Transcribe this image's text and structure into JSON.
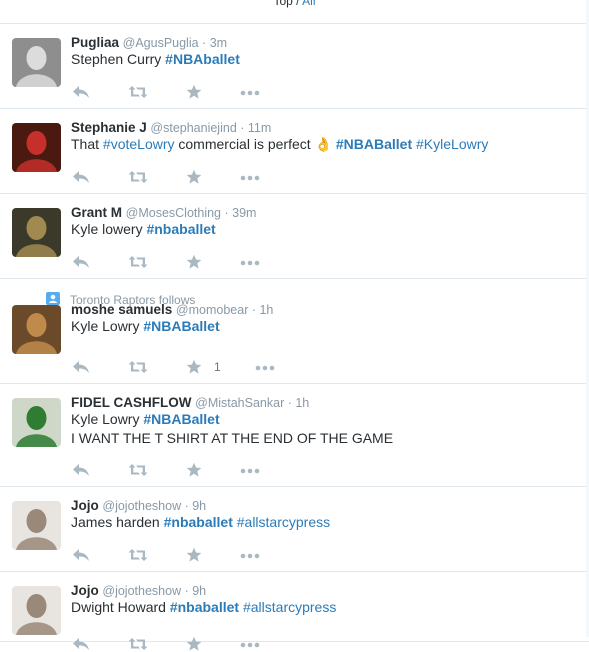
{
  "filter": {
    "top_label": "Top",
    "separator": " / ",
    "all_label": "All"
  },
  "tweets": [
    {
      "fullname": "Pugliaa",
      "username": "@AgusPuglia",
      "time": "3m",
      "text_parts": [
        {
          "t": "Stephen Curry "
        },
        {
          "t": "#NBAballet",
          "tag": true,
          "bold": true
        }
      ],
      "avatar_colors": [
        "#8e8e8e",
        "#dcdcdc"
      ]
    },
    {
      "fullname": "Stephanie J",
      "username": "@stephaniejind",
      "time": "11m",
      "text_parts": [
        {
          "t": "That "
        },
        {
          "t": "#voteLowry",
          "tag": true
        },
        {
          "t": " commercial is perfect "
        },
        {
          "t": "👌",
          "emoji": true
        },
        {
          "t": " "
        },
        {
          "t": "#NBABallet",
          "tag": true,
          "bold": true
        },
        {
          "t": " "
        },
        {
          "t": "#KyleLowry",
          "tag": true
        }
      ],
      "avatar_colors": [
        "#4a1a10",
        "#c62f2a"
      ]
    },
    {
      "fullname": "Grant M",
      "username": "@MosesClothing",
      "time": "39m",
      "text_parts": [
        {
          "t": "Kyle lowery "
        },
        {
          "t": "#nbaballet",
          "tag": true,
          "bold": true
        }
      ],
      "avatar_colors": [
        "#3b3a2a",
        "#a08a50"
      ]
    },
    {
      "context": "Toronto Raptors follows",
      "fullname": "moshe samuels",
      "username": "@momobear",
      "time": "1h",
      "text_parts": [
        {
          "t": "Kyle Lowry "
        },
        {
          "t": "#NBABallet",
          "tag": true,
          "bold": true
        }
      ],
      "favorites": "1",
      "avatar_colors": [
        "#6b4a2a",
        "#c08a4a"
      ]
    },
    {
      "fullname": "FIDEL CASHFLOW",
      "username": "@MistahSankar",
      "time": "1h",
      "text_parts": [
        {
          "t": "Kyle Lowry "
        },
        {
          "t": "#NBABallet",
          "tag": true,
          "bold": true
        }
      ],
      "text_line2": "I WANT THE T SHIRT AT THE END OF THE GAME",
      "avatar_colors": [
        "#cfd8c8",
        "#2e7d32"
      ]
    },
    {
      "fullname": "Jojo",
      "username": "@jojotheshow",
      "time": "9h",
      "text_parts": [
        {
          "t": "James harden "
        },
        {
          "t": "#nbaballet",
          "tag": true,
          "bold": true
        },
        {
          "t": " "
        },
        {
          "t": "#allstarcypress",
          "tag": true
        }
      ],
      "avatar_colors": [
        "#e8e4e0",
        "#9a8878"
      ]
    },
    {
      "fullname": "Jojo",
      "username": "@jojotheshow",
      "time": "9h",
      "text_parts": [
        {
          "t": "Dwight Howard "
        },
        {
          "t": "#nbaballet",
          "tag": true,
          "bold": true
        },
        {
          "t": " "
        },
        {
          "t": "#allstarcypress",
          "tag": true
        }
      ],
      "avatar_colors": [
        "#e8e4e0",
        "#9a8878"
      ]
    }
  ],
  "icons": {
    "reply": "reply-icon",
    "retweet": "retweet-icon",
    "favorite": "star-icon",
    "more": "more-icon",
    "follows": "person-badge-icon"
  },
  "colors": {
    "link": "#2b7bb9",
    "muted": "#8899a6",
    "action": "#aab8c2",
    "border": "#e1e8ed"
  }
}
